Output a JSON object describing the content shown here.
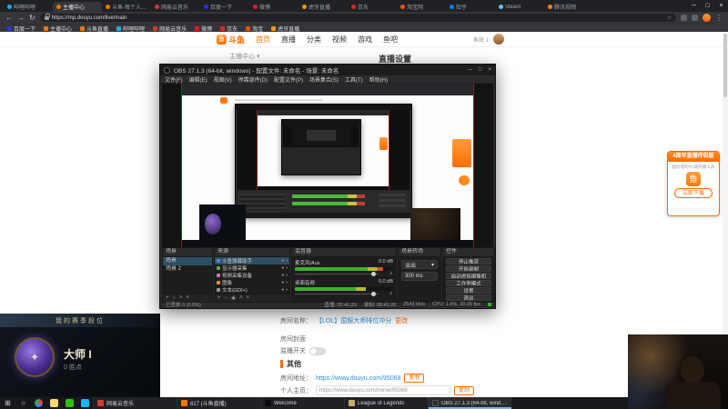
{
  "browser": {
    "tabs": [
      {
        "title": "哔哩哔哩",
        "color": "#23ade5"
      },
      {
        "title": "主播中心",
        "color": "#ff7500"
      },
      {
        "title": "斗鱼-每个人的直播平台",
        "color": "#ff7500"
      },
      {
        "title": "网易云音乐",
        "color": "#d33a31"
      },
      {
        "title": "百度一下",
        "color": "#2932e1"
      },
      {
        "title": "微博",
        "color": "#e6162d"
      },
      {
        "title": "虎牙直播",
        "color": "#ff9600"
      },
      {
        "title": "京东",
        "color": "#e1251b"
      },
      {
        "title": "淘宝网",
        "color": "#ff5000"
      },
      {
        "title": "知乎",
        "color": "#0084ff"
      },
      {
        "title": "Steam",
        "color": "#66c0f4"
      },
      {
        "title": "腾讯视频",
        "color": "#ff820f"
      }
    ],
    "window_controls": {
      "minimize": "─",
      "maximize": "□",
      "close": "×"
    },
    "nav": {
      "back": "←",
      "forward": "→",
      "refresh": "↻"
    },
    "url": "https://mp.douyu.com/live/main",
    "star_icon": "☆",
    "menu_icon": "⋮",
    "bookmarks": [
      {
        "label": "百度一下",
        "color": "#2932e1"
      },
      {
        "label": "主播中心",
        "color": "#ff7500"
      },
      {
        "label": "斗鱼直播",
        "color": "#ff7500"
      },
      {
        "label": "哔哩哔哩",
        "color": "#23ade5"
      },
      {
        "label": "网易云音乐",
        "color": "#d33a31"
      },
      {
        "label": "微博",
        "color": "#e6162d"
      },
      {
        "label": "京东",
        "color": "#e1251b"
      },
      {
        "label": "淘宝",
        "color": "#ff5000"
      },
      {
        "label": "虎牙直播",
        "color": "#ff9600"
      }
    ]
  },
  "site": {
    "logo_badge": "鱼",
    "logo": "斗鱼",
    "nav": [
      "首页",
      "直播",
      "分类",
      "视频",
      "游戏",
      "鱼吧"
    ],
    "user_currency": "鱼翅 1",
    "breadcrumb": "主播中心 ▾",
    "page_title": "直播设置",
    "form": {
      "room_name_label": "房间名称：",
      "room_name_value": "【LOL】国服大师排位冲分",
      "room_name_action": "更改",
      "cover_label": "房间封面",
      "monitor_label": "监播开关",
      "section_other": "其他",
      "room_link_label": "房间地址：",
      "room_link_value": "https://www.douyu.com/95068",
      "home_label": "个人主页：",
      "home_value": "https://www.douyu.com/home/95068",
      "copy": "复制"
    },
    "promo": {
      "badge": "4周年直播伴侣版",
      "desc": "超好用的PC端开播工具",
      "mascot": "鱼",
      "button": "立即下载"
    }
  },
  "obs": {
    "title": "OBS 27.1.3 (64-bit, windows) - 配置文件: 未命名 - 场景: 未命名",
    "window_controls": {
      "minimize": "─",
      "maximize": "□",
      "close": "×"
    },
    "menu": [
      "文件(F)",
      "编辑(E)",
      "视图(V)",
      "停靠部件(D)",
      "配置文件(P)",
      "场景集合(S)",
      "工具(T)",
      "帮助(H)"
    ],
    "scenes": {
      "title": "场景",
      "items": [
        "场景",
        "场景 2"
      ]
    },
    "sources": {
      "title": "来源",
      "items": [
        "斗鱼弹幕助手",
        "显示器采集",
        "视频采集设备",
        "图像",
        "文本(GDI+)"
      ],
      "eye": "●",
      "lock": "▪"
    },
    "mixer": {
      "title": "混音器",
      "speaker": "♪",
      "channels": [
        {
          "name": "麦克风/Aux",
          "db": "0.0 dB"
        },
        {
          "name": "桌面音频",
          "db": "0.0 dB"
        }
      ]
    },
    "transition": {
      "title": "场景转场",
      "selected": "淡出",
      "caret": "▾",
      "duration": "300 ms"
    },
    "controls": {
      "title": "控件",
      "buttons": [
        "停止推流",
        "开始录制",
        "启动虚拟摄像机",
        "工作室模式",
        "设置",
        "退出"
      ]
    },
    "dock_tools": {
      "add": "+",
      "remove": "−",
      "up": "˄",
      "down": "˅",
      "gear": "✱"
    },
    "status": {
      "dropped": "已丢帧 0 (0.0%)",
      "live": "直播: 00:41:29",
      "rec": "录制: 00:41:26",
      "kbps": "2543 kb/s",
      "cpu": "CPU: 1.6%, 30.00 fps"
    }
  },
  "lol": {
    "panel_title": "我的赛季段位",
    "tier": "大师 I",
    "points": "0 胜点",
    "emblem_star": "✦"
  },
  "taskbar": {
    "start": "⊞",
    "search": "○",
    "apps": [
      {
        "label": "网易云音乐",
        "color": "#d33a31"
      },
      {
        "label": "817 (斗鱼直播)",
        "color": "#ff7500"
      },
      {
        "label": "Welcome",
        "color": "#0a0a0a"
      },
      {
        "label": "League of Legends",
        "color": "#c8aa6e"
      },
      {
        "label": "OBS 27.1.3 (64-bit, windows)",
        "color": "#2b2b2b"
      }
    ]
  },
  "colors": {
    "accent": "#ff6a00",
    "live_green": "#2eb82e",
    "select_blue": "#2e4f63"
  }
}
